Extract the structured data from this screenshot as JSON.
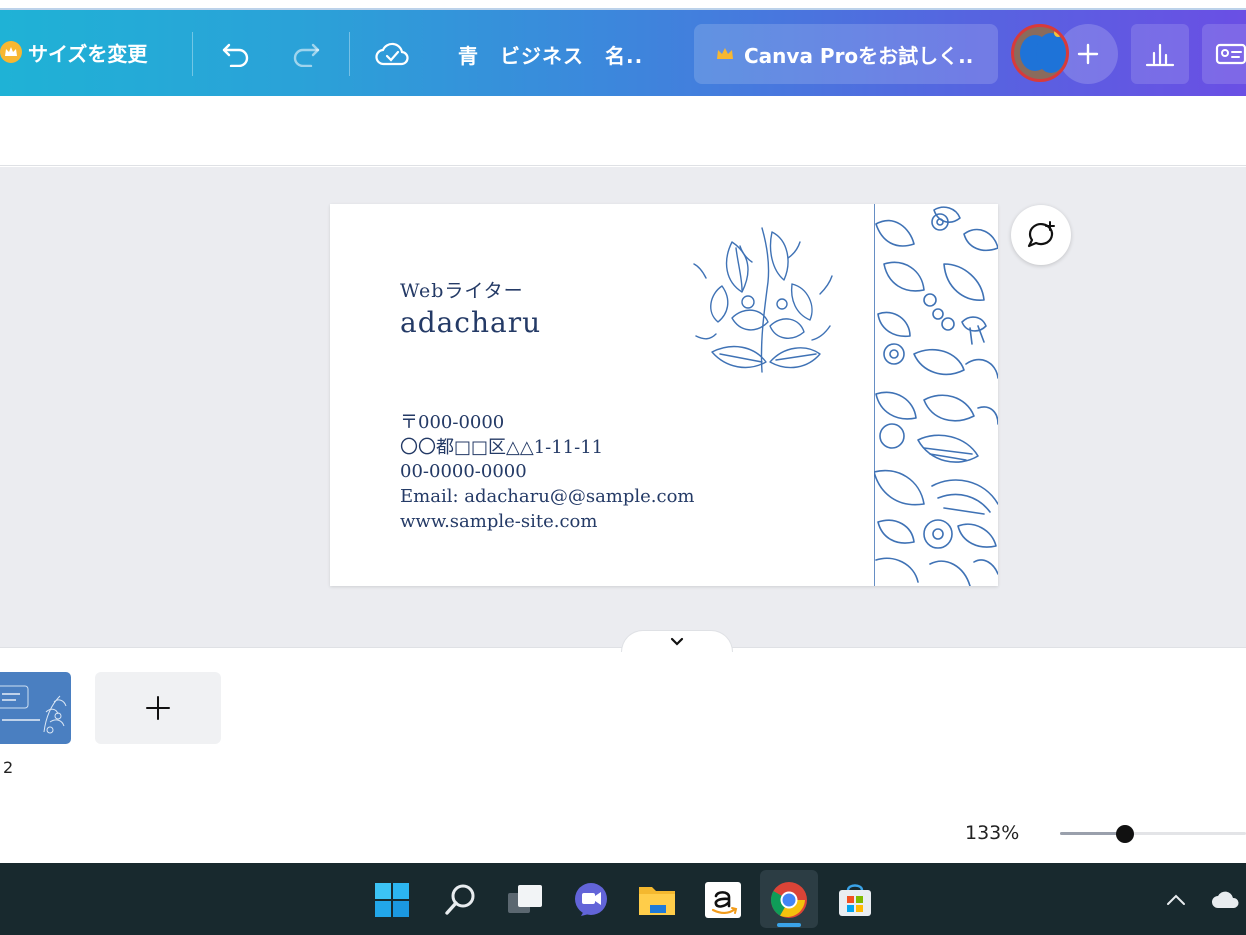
{
  "toolbar": {
    "resize_label": "サイズを変更",
    "doc_title": "青　ビジネス　名..",
    "pro_label": "Canva Proをお試しく..",
    "icons": {
      "crown": "crown-icon",
      "undo": "undo-icon",
      "redo": "redo-icon",
      "cloud": "cloud-saved-icon",
      "add": "plus-icon",
      "insights": "bar-chart-icon",
      "present": "id-card-icon"
    }
  },
  "card": {
    "job_title": "Webライター",
    "name": "adacharu",
    "postal": "〒000-0000",
    "address": "〇〇都□□区△△1-11-11",
    "phone": "00-0000-0000",
    "email": "Email: adacharu@@sample.com",
    "website": "www.sample-site.com",
    "text_color": "#243a66",
    "floral_color": "#3f72b5"
  },
  "pages": {
    "thumb_number": "2",
    "add_page_icon": "plus-icon",
    "collapse_icon": "chevron-down-icon"
  },
  "zoom": {
    "label": "133%",
    "level_fraction": 0.35
  },
  "taskbar": {
    "icons": [
      "windows-start-icon",
      "search-icon",
      "task-view-icon",
      "teams-chat-icon",
      "file-explorer-icon",
      "amazon-icon",
      "chrome-icon",
      "microsoft-store-icon"
    ],
    "tray_icons": [
      "chevron-up-icon",
      "onedrive-cloud-icon"
    ]
  },
  "colors": {
    "gradient_start": "#1fb2d6",
    "gradient_end": "#6a4fe4",
    "canvas_bg": "#ebecf0",
    "taskbar_bg": "#18292e"
  }
}
